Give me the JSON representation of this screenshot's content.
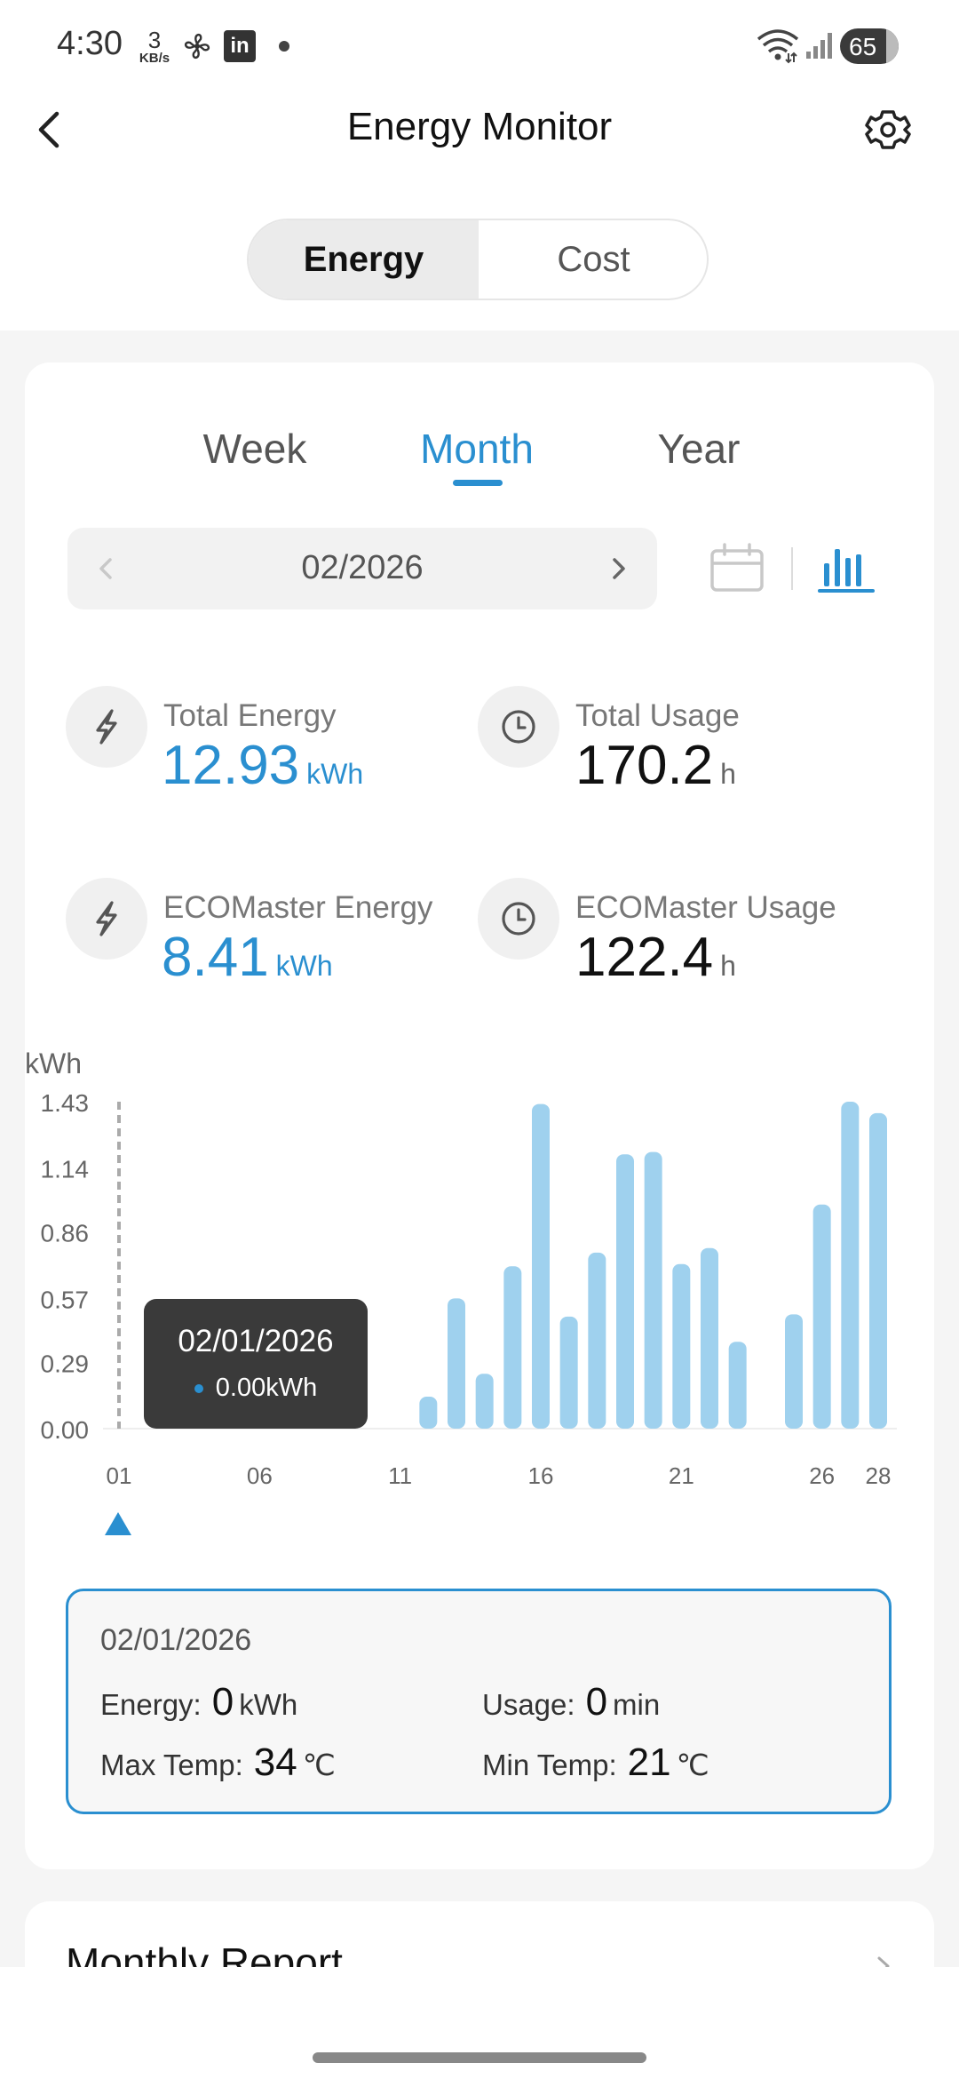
{
  "status_bar": {
    "time": "4:30",
    "net_speed_value": "3",
    "net_speed_unit": "KB/s",
    "linkedin_label": "in",
    "battery": "65"
  },
  "header": {
    "title": "Energy Monitor"
  },
  "toggle": {
    "options": [
      "Energy",
      "Cost"
    ],
    "selected": "Energy"
  },
  "period_tabs": {
    "items": [
      "Week",
      "Month",
      "Year"
    ],
    "selected": "Month"
  },
  "date_selector": {
    "value": "02/2026"
  },
  "stats": {
    "total_energy": {
      "label": "Total Energy",
      "value": "12.93",
      "unit": "kWh"
    },
    "total_usage": {
      "label": "Total Usage",
      "value": "170.2",
      "unit": "h"
    },
    "eco_energy": {
      "label": "ECOMaster Energy",
      "value": "8.41",
      "unit": "kWh"
    },
    "eco_usage": {
      "label": "ECOMaster Usage",
      "value": "122.4",
      "unit": "h"
    }
  },
  "chart_data": {
    "type": "bar",
    "ylabel": "kWh",
    "ylim": [
      0,
      1.43
    ],
    "y_ticks": [
      "0.00",
      "0.29",
      "0.57",
      "0.86",
      "1.14",
      "1.43"
    ],
    "x_tick_labels": [
      "01",
      "06",
      "11",
      "16",
      "21",
      "26",
      "28"
    ],
    "x_tick_days": [
      1,
      6,
      11,
      16,
      21,
      26,
      28
    ],
    "days": [
      1,
      2,
      3,
      4,
      5,
      6,
      7,
      8,
      9,
      10,
      11,
      12,
      13,
      14,
      15,
      16,
      17,
      18,
      19,
      20,
      21,
      22,
      23,
      24,
      25,
      26,
      27,
      28
    ],
    "values": [
      0,
      0,
      0,
      0,
      0,
      0,
      0,
      0,
      0,
      0,
      0,
      0.14,
      0.57,
      0.24,
      0.71,
      1.42,
      0.49,
      0.77,
      1.2,
      1.21,
      0.72,
      0.79,
      0.38,
      0,
      0.5,
      0.98,
      1.43,
      1.38
    ],
    "bar_color": "#9fd1ee",
    "selected_day": 1
  },
  "tooltip": {
    "date": "02/01/2026",
    "value": "0.00kWh"
  },
  "detail": {
    "date": "02/01/2026",
    "energy_label": "Energy:",
    "energy_value": "0",
    "energy_unit": "kWh",
    "usage_label": "Usage:",
    "usage_value": "0",
    "usage_unit": "min",
    "max_temp_label": "Max Temp:",
    "max_temp_value": "34",
    "max_temp_unit": "℃",
    "min_temp_label": "Min Temp:",
    "min_temp_value": "21",
    "min_temp_unit": "℃"
  },
  "report": {
    "title": "Monthly Report"
  },
  "colors": {
    "accent": "#2a8fd0",
    "bar": "#9fd1ee"
  }
}
